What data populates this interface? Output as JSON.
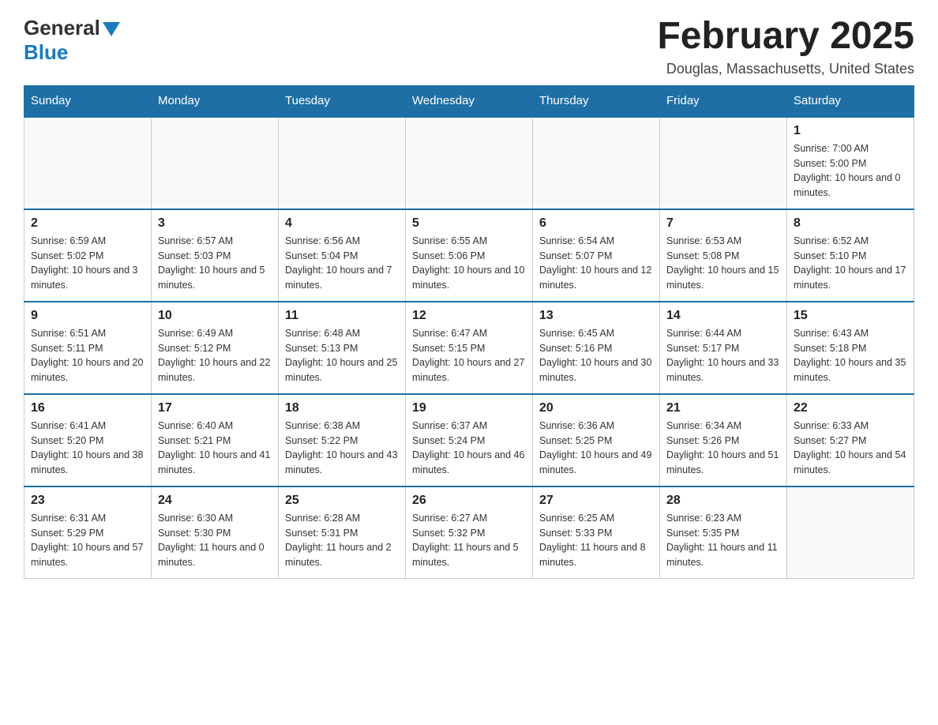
{
  "header": {
    "logo_general": "General",
    "logo_blue": "Blue",
    "month_title": "February 2025",
    "location": "Douglas, Massachusetts, United States"
  },
  "weekdays": [
    "Sunday",
    "Monday",
    "Tuesday",
    "Wednesday",
    "Thursday",
    "Friday",
    "Saturday"
  ],
  "weeks": [
    [
      {
        "day": "",
        "info": ""
      },
      {
        "day": "",
        "info": ""
      },
      {
        "day": "",
        "info": ""
      },
      {
        "day": "",
        "info": ""
      },
      {
        "day": "",
        "info": ""
      },
      {
        "day": "",
        "info": ""
      },
      {
        "day": "1",
        "info": "Sunrise: 7:00 AM\nSunset: 5:00 PM\nDaylight: 10 hours and 0 minutes."
      }
    ],
    [
      {
        "day": "2",
        "info": "Sunrise: 6:59 AM\nSunset: 5:02 PM\nDaylight: 10 hours and 3 minutes."
      },
      {
        "day": "3",
        "info": "Sunrise: 6:57 AM\nSunset: 5:03 PM\nDaylight: 10 hours and 5 minutes."
      },
      {
        "day": "4",
        "info": "Sunrise: 6:56 AM\nSunset: 5:04 PM\nDaylight: 10 hours and 7 minutes."
      },
      {
        "day": "5",
        "info": "Sunrise: 6:55 AM\nSunset: 5:06 PM\nDaylight: 10 hours and 10 minutes."
      },
      {
        "day": "6",
        "info": "Sunrise: 6:54 AM\nSunset: 5:07 PM\nDaylight: 10 hours and 12 minutes."
      },
      {
        "day": "7",
        "info": "Sunrise: 6:53 AM\nSunset: 5:08 PM\nDaylight: 10 hours and 15 minutes."
      },
      {
        "day": "8",
        "info": "Sunrise: 6:52 AM\nSunset: 5:10 PM\nDaylight: 10 hours and 17 minutes."
      }
    ],
    [
      {
        "day": "9",
        "info": "Sunrise: 6:51 AM\nSunset: 5:11 PM\nDaylight: 10 hours and 20 minutes."
      },
      {
        "day": "10",
        "info": "Sunrise: 6:49 AM\nSunset: 5:12 PM\nDaylight: 10 hours and 22 minutes."
      },
      {
        "day": "11",
        "info": "Sunrise: 6:48 AM\nSunset: 5:13 PM\nDaylight: 10 hours and 25 minutes."
      },
      {
        "day": "12",
        "info": "Sunrise: 6:47 AM\nSunset: 5:15 PM\nDaylight: 10 hours and 27 minutes."
      },
      {
        "day": "13",
        "info": "Sunrise: 6:45 AM\nSunset: 5:16 PM\nDaylight: 10 hours and 30 minutes."
      },
      {
        "day": "14",
        "info": "Sunrise: 6:44 AM\nSunset: 5:17 PM\nDaylight: 10 hours and 33 minutes."
      },
      {
        "day": "15",
        "info": "Sunrise: 6:43 AM\nSunset: 5:18 PM\nDaylight: 10 hours and 35 minutes."
      }
    ],
    [
      {
        "day": "16",
        "info": "Sunrise: 6:41 AM\nSunset: 5:20 PM\nDaylight: 10 hours and 38 minutes."
      },
      {
        "day": "17",
        "info": "Sunrise: 6:40 AM\nSunset: 5:21 PM\nDaylight: 10 hours and 41 minutes."
      },
      {
        "day": "18",
        "info": "Sunrise: 6:38 AM\nSunset: 5:22 PM\nDaylight: 10 hours and 43 minutes."
      },
      {
        "day": "19",
        "info": "Sunrise: 6:37 AM\nSunset: 5:24 PM\nDaylight: 10 hours and 46 minutes."
      },
      {
        "day": "20",
        "info": "Sunrise: 6:36 AM\nSunset: 5:25 PM\nDaylight: 10 hours and 49 minutes."
      },
      {
        "day": "21",
        "info": "Sunrise: 6:34 AM\nSunset: 5:26 PM\nDaylight: 10 hours and 51 minutes."
      },
      {
        "day": "22",
        "info": "Sunrise: 6:33 AM\nSunset: 5:27 PM\nDaylight: 10 hours and 54 minutes."
      }
    ],
    [
      {
        "day": "23",
        "info": "Sunrise: 6:31 AM\nSunset: 5:29 PM\nDaylight: 10 hours and 57 minutes."
      },
      {
        "day": "24",
        "info": "Sunrise: 6:30 AM\nSunset: 5:30 PM\nDaylight: 11 hours and 0 minutes."
      },
      {
        "day": "25",
        "info": "Sunrise: 6:28 AM\nSunset: 5:31 PM\nDaylight: 11 hours and 2 minutes."
      },
      {
        "day": "26",
        "info": "Sunrise: 6:27 AM\nSunset: 5:32 PM\nDaylight: 11 hours and 5 minutes."
      },
      {
        "day": "27",
        "info": "Sunrise: 6:25 AM\nSunset: 5:33 PM\nDaylight: 11 hours and 8 minutes."
      },
      {
        "day": "28",
        "info": "Sunrise: 6:23 AM\nSunset: 5:35 PM\nDaylight: 11 hours and 11 minutes."
      },
      {
        "day": "",
        "info": ""
      }
    ]
  ]
}
